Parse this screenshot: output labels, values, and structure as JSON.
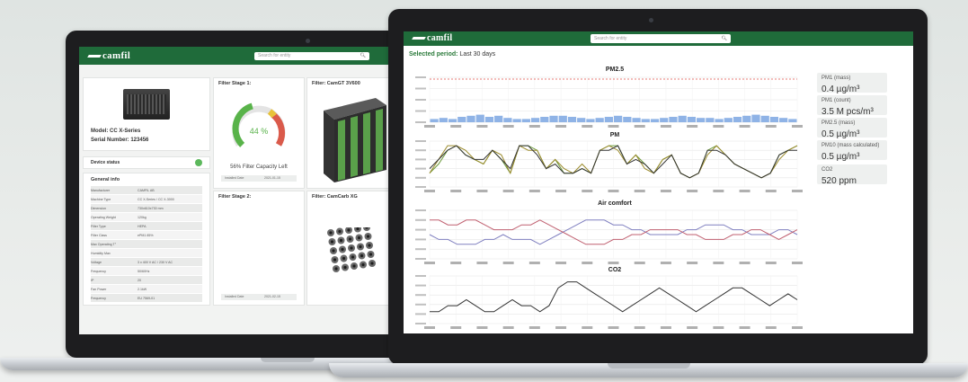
{
  "left_app": {
    "brand": "camfil",
    "search_placeholder": "Search for entity",
    "device": {
      "model_label": "Model: CC X-Series",
      "serial_label": "Serial Number: 123456",
      "status_label": "Device status",
      "status_color": "#5cb85c"
    },
    "general_info": {
      "title": "General info",
      "rows": [
        {
          "key": "Manufacturer",
          "value": "CAMFIL AB"
        },
        {
          "key": "Machine Type",
          "value": "CC X-Series / CC X-3000"
        },
        {
          "key": "Dimension",
          "value": "730x610x730 mm"
        },
        {
          "key": "Operating Weight",
          "value": "120kg"
        },
        {
          "key": "Filter Type",
          "value": "HEPA"
        },
        {
          "key": "Filter Class",
          "value": "ePM1 85%"
        },
        {
          "key": "Max Operating T°",
          "value": ""
        },
        {
          "key": "Humidity Max",
          "value": ""
        },
        {
          "key": "Voltage",
          "value": "3 x 400 V AC / 230 V AC"
        },
        {
          "key": "Frequency",
          "value": "50/60Hz"
        },
        {
          "key": "IP",
          "value": "20"
        },
        {
          "key": "Fan Power",
          "value": "2.1kW"
        },
        {
          "key": "Frequency",
          "value": "EU 7569-01"
        }
      ]
    },
    "stage1": {
      "title": "Filter Stage 1:",
      "gauge_percent": 44,
      "gauge_text": "44 %",
      "capacity_text": "56% Filter Capacity Left",
      "installed_label": "Installed Date",
      "installed_value": "2021-01-15"
    },
    "filter1": {
      "title": "Filter: CamGT 3V600"
    },
    "stage2": {
      "title": "Filter Stage 2:",
      "installed_label": "Installed Date",
      "installed_value": "2021-02-15"
    },
    "filter2": {
      "title": "Filter: CamCarb XG"
    }
  },
  "right_app": {
    "brand": "camfil",
    "search_placeholder": "Search for entity",
    "period_label": "Selected period:",
    "period_value": "Last 30 days",
    "metrics": [
      {
        "label": "PM1 (mass)",
        "value": "0.4 µg/m³"
      },
      {
        "label": "PM1 (count)",
        "value": "3.5 M pcs/m³"
      },
      {
        "label": "PM2.5 (mass)",
        "value": "0.5 µg/m³"
      },
      {
        "label": "PM10 (mass calculated)",
        "value": "0.5 µg/m³"
      },
      {
        "label": "CO2",
        "value": "520 ppm"
      }
    ]
  },
  "colors": {
    "brand_green": "#1f6b3a",
    "bar_blue": "#8fb3e6",
    "threshold_red": "#e0504a",
    "pm_green": "#6a9a3a",
    "pm_olive": "#9a8a2a",
    "pm_dark": "#333333",
    "air_purple": "#8080c0",
    "air_red": "#c06070",
    "gauge_green": "#59b34a",
    "gauge_red": "#d84a3a"
  },
  "chart_data": [
    {
      "type": "bar",
      "title": "PM2.5",
      "values": [
        3,
        4,
        3,
        5,
        6,
        7,
        5,
        6,
        4,
        3,
        3,
        4,
        5,
        6,
        6,
        5,
        4,
        3,
        4,
        5,
        6,
        5,
        4,
        3,
        3,
        4,
        5,
        6,
        5,
        4,
        4,
        3,
        4,
        5,
        6,
        7,
        6,
        5,
        4,
        3
      ]
    },
    {
      "type": "line",
      "title": "PM",
      "series": [
        {
          "values": [
            3,
            5,
            8,
            9,
            7,
            6,
            5,
            8,
            6,
            3,
            9,
            9,
            8,
            4,
            6,
            3,
            3,
            4,
            3,
            8,
            9,
            9,
            5,
            7,
            5,
            3,
            6,
            7,
            3,
            2,
            3,
            8,
            9,
            7,
            5,
            4,
            3,
            2,
            3,
            7,
            8,
            9
          ]
        },
        {
          "values": [
            3,
            6,
            9,
            9,
            8,
            6,
            5,
            8,
            7,
            3,
            9,
            8,
            8,
            4,
            6,
            4,
            3,
            5,
            3,
            8,
            9,
            8,
            5,
            7,
            4,
            3,
            6,
            7,
            3,
            2,
            3,
            7,
            9,
            7,
            5,
            4,
            3,
            2,
            3,
            6,
            8,
            9
          ]
        },
        {
          "values": [
            4,
            6,
            8,
            9,
            7,
            6,
            6,
            8,
            6,
            4,
            9,
            9,
            7,
            4,
            5,
            3,
            3,
            4,
            3,
            8,
            8,
            9,
            5,
            6,
            5,
            3,
            5,
            7,
            3,
            2,
            3,
            8,
            8,
            7,
            5,
            4,
            3,
            2,
            3,
            7,
            8,
            8
          ]
        }
      ]
    },
    {
      "type": "line",
      "title": "Air comfort",
      "series": [
        {
          "values": [
            5,
            4,
            4,
            3,
            3,
            3,
            4,
            4,
            5,
            4,
            4,
            4,
            3,
            4,
            5,
            6,
            7,
            8,
            8,
            8,
            7,
            7,
            6,
            6,
            5,
            5,
            5,
            5,
            6,
            6,
            7,
            7,
            7,
            6,
            6,
            5,
            5,
            5,
            6,
            6,
            5
          ]
        },
        {
          "values": [
            8,
            8,
            7,
            7,
            8,
            8,
            7,
            6,
            6,
            6,
            7,
            7,
            8,
            7,
            6,
            5,
            4,
            3,
            3,
            3,
            4,
            4,
            5,
            5,
            6,
            6,
            6,
            6,
            5,
            5,
            4,
            4,
            4,
            5,
            5,
            6,
            6,
            5,
            4,
            5,
            6
          ]
        }
      ]
    },
    {
      "type": "line",
      "title": "CO2",
      "values": [
        2,
        2,
        3,
        3,
        4,
        3,
        2,
        2,
        3,
        4,
        3,
        3,
        2,
        3,
        6,
        7,
        7,
        6,
        5,
        4,
        3,
        2,
        3,
        4,
        5,
        6,
        5,
        4,
        3,
        2,
        3,
        4,
        5,
        6,
        6,
        5,
        4,
        3,
        4,
        5,
        4
      ]
    }
  ]
}
